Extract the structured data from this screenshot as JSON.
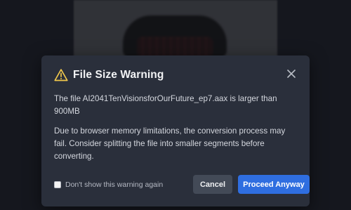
{
  "dialog": {
    "title": "File Size Warning",
    "message_file": "The file AI2041TenVisionsforOurFuture_ep7.aax is larger than 900MB",
    "message_detail": "Due to browser memory limitations, the conversion process may fail. Consider splitting the file into smaller segments before converting.",
    "checkbox_label": "Don't show this warning again",
    "checkbox_checked": false,
    "cancel_label": "Cancel",
    "proceed_label": "Proceed Anyway"
  },
  "icons": {
    "warning": "warning-triangle-icon",
    "close": "close-icon"
  },
  "colors": {
    "warning": "#f2c94c",
    "primary": "#2f6ee0",
    "secondary": "#434a57",
    "modal_bg": "#2a2f3b"
  }
}
